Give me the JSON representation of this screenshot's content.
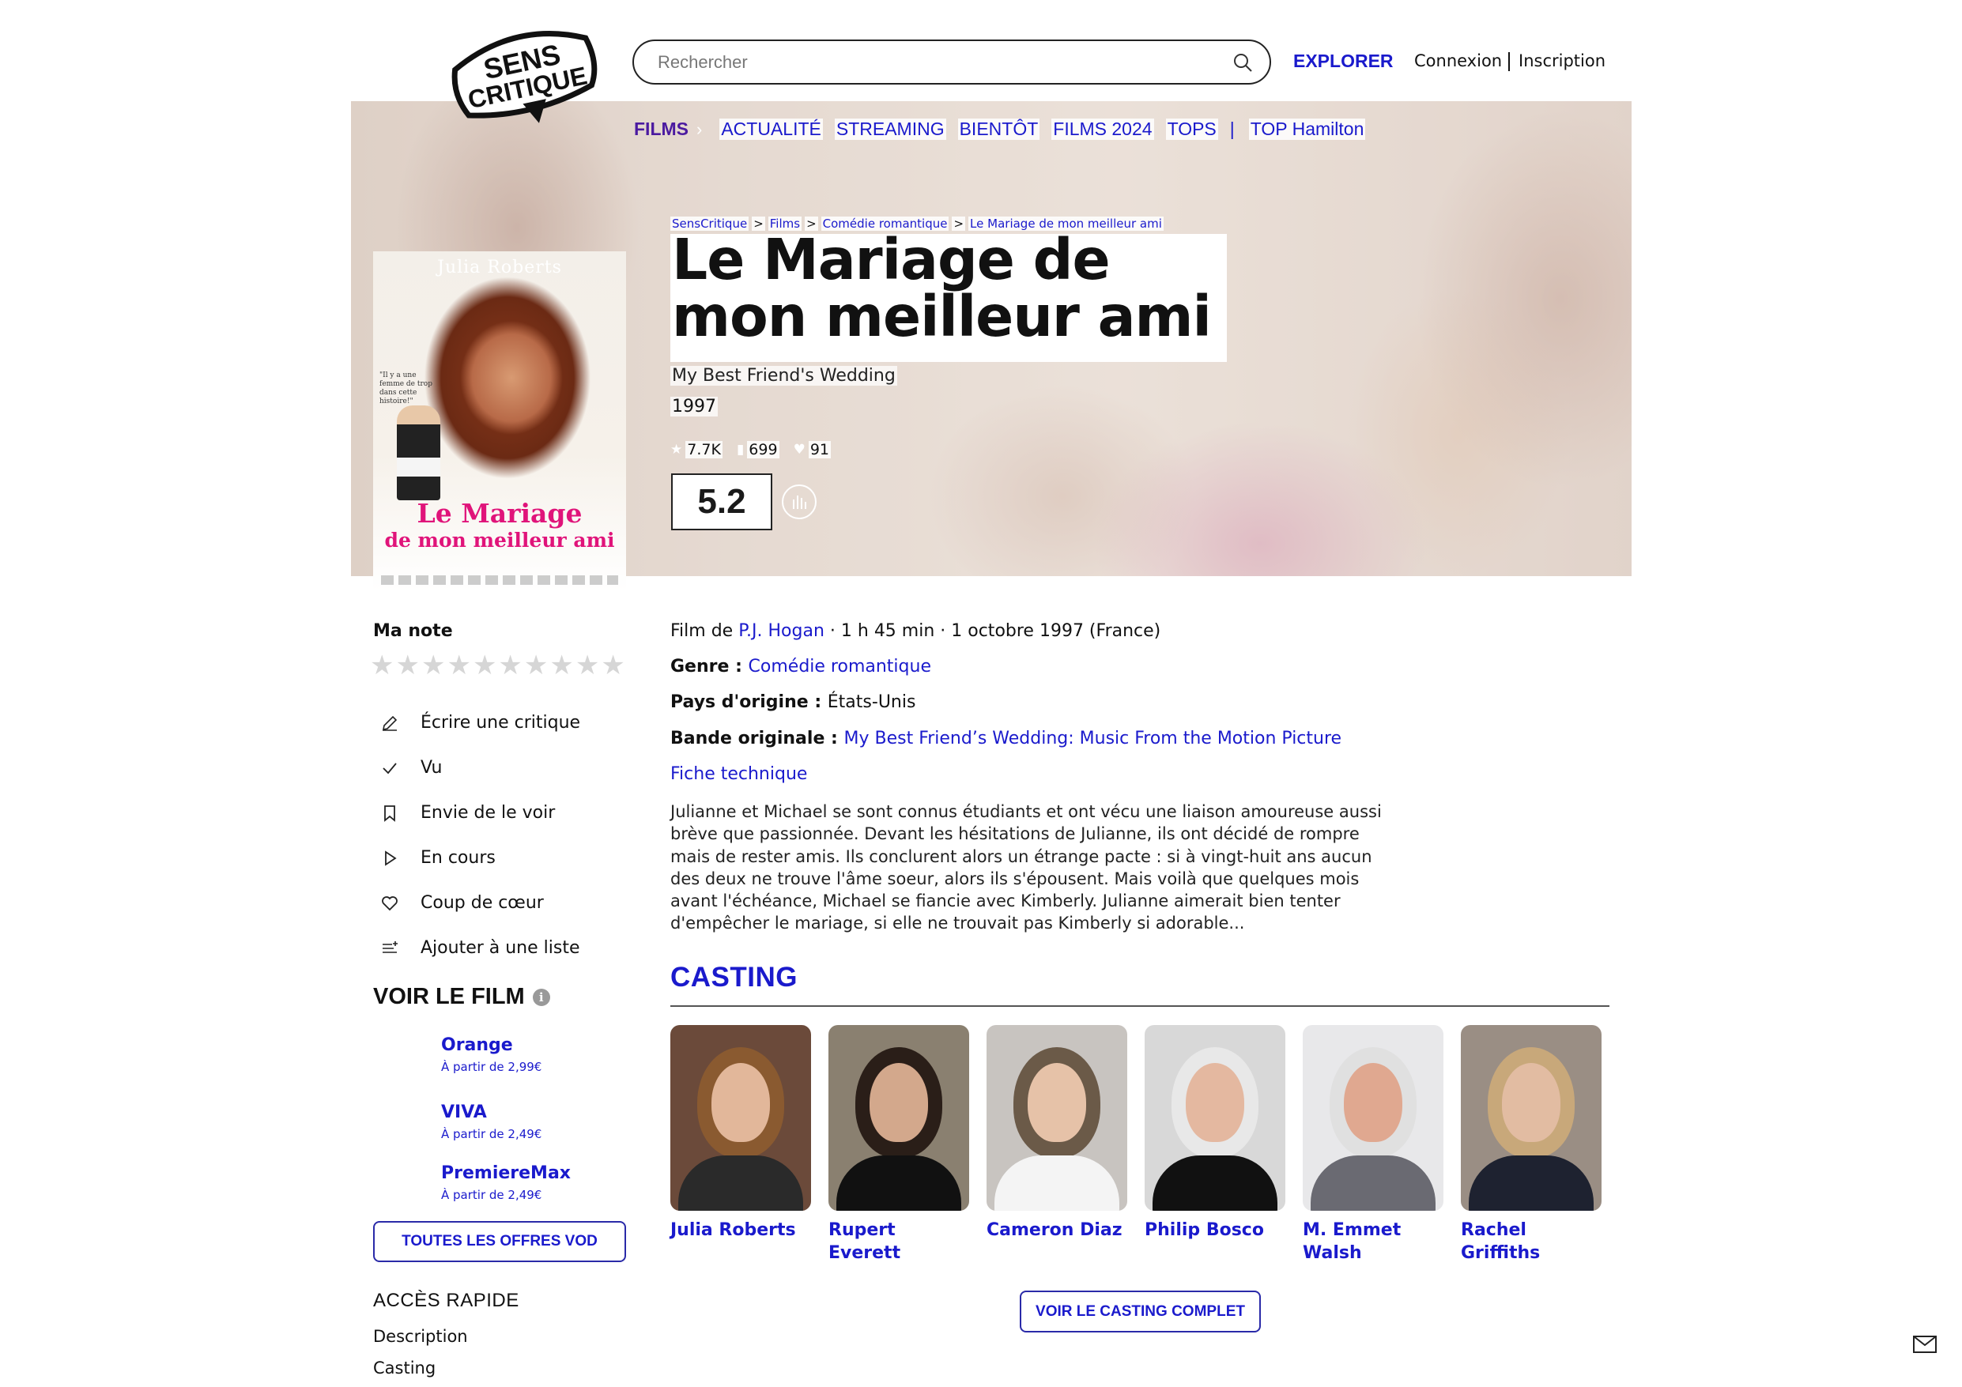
{
  "header": {
    "search_placeholder": "Rechercher",
    "explorer": "EXPLORER",
    "connexion": "Connexion",
    "inscription": "Inscription",
    "logo_text_1": "SENS",
    "logo_text_2": "CRITIQUE"
  },
  "catnav": {
    "films": "FILMS",
    "chevron": "›",
    "items": [
      "ACTUALITÉ",
      "STREAMING",
      "BIENTÔT",
      "FILMS 2024",
      "TOPS"
    ],
    "separator": "|",
    "top_extra": "TOP Hamilton"
  },
  "breadcrumb": {
    "items": [
      "SensCritique",
      "Films",
      "Comédie romantique",
      "Le Mariage de mon meilleur ami"
    ],
    "gt": ">"
  },
  "movie": {
    "title": "Le Mariage de mon meilleur ami",
    "original_title": "My Best Friend's Wedding",
    "year": "1997",
    "stats": {
      "ratings": "7.7K",
      "wishlist": "699",
      "favorites": "91"
    },
    "score": "5.2",
    "poster": {
      "author": "Julia Roberts",
      "quote": "\"Il y a une femme de trop dans cette histoire!\"",
      "title_line1": "Le Mariage",
      "title_line2": "de mon meilleur ami"
    }
  },
  "sidebar": {
    "ma_note": "Ma note",
    "star_glyph": "★",
    "star_count": 10,
    "actions": [
      {
        "label": "Écrire une critique",
        "icon": "pencil-icon"
      },
      {
        "label": "Vu",
        "icon": "check-icon"
      },
      {
        "label": "Envie de le voir",
        "icon": "bookmark-icon"
      },
      {
        "label": "En cours",
        "icon": "play-icon"
      },
      {
        "label": "Coup de cœur",
        "icon": "heart-icon"
      },
      {
        "label": "Ajouter à une liste",
        "icon": "list-add-icon"
      }
    ],
    "voir_le_film": "VOIR LE FILM",
    "info_glyph": "i",
    "offers": [
      {
        "name": "Orange",
        "price": "À partir de 2,99€"
      },
      {
        "name": "VIVA",
        "price": "À partir de 2,49€"
      },
      {
        "name": "PremiereMax",
        "price": "À partir de 2,49€"
      }
    ],
    "vod_button": "TOUTES LES OFFRES VOD",
    "acces_rapide": "ACCÈS RAPIDE",
    "quick_links": [
      "Description",
      "Casting"
    ]
  },
  "details": {
    "film_de_prefix": "Film de ",
    "director": "P.J. Hogan",
    "film_meta": " · 1 h 45 min · 1 octobre 1997 (France)",
    "genre_label": "Genre : ",
    "genre": "Comédie romantique",
    "pays_label": "Pays d'origine : ",
    "pays": "États-Unis",
    "bo_label": "Bande originale : ",
    "bo": "My Best Friend’s Wedding: Music From the Motion Picture",
    "fiche": "Fiche technique",
    "synopsis": "Julianne et Michael se sont connus étudiants et ont vécu une liaison amoureuse aussi brève que passionnée. Devant les hésitations de Julianne, ils ont décidé de rompre mais de rester amis. Ils conclurent alors un étrange pacte : si à vingt-huit ans aucun des deux ne trouve l'âme soeur, alors ils s'épousent. Mais voilà que quelques mois avant l'échéance, Michael se fiancie avec Kimberly. Julianne aimerait bien tenter d'empêcher le mariage, si elle ne trouvait pas Kimberly si adorable..."
  },
  "casting": {
    "title": "CASTING",
    "actors": [
      {
        "name": "Julia Roberts",
        "bg": "#6b4a3a",
        "hair": "#8a5a30",
        "skin": "#e2b79a",
        "cloth": "#2a2a2a"
      },
      {
        "name": "Rupert Everett",
        "bg": "#8a8070",
        "hair": "#2a1e18",
        "skin": "#d3a88c",
        "cloth": "#111111"
      },
      {
        "name": "Cameron Diaz",
        "bg": "#c8c4c0",
        "hair": "#6b5a48",
        "skin": "#e6c2a8",
        "cloth": "#f4f4f4"
      },
      {
        "name": "Philip Bosco",
        "bg": "#d8d8d8",
        "hair": "#e8e8e8",
        "skin": "#e4b8a0",
        "cloth": "#111111"
      },
      {
        "name": "M. Emmet Walsh",
        "bg": "#e8e8ea",
        "hair": "#e0e0e0",
        "skin": "#e0a890",
        "cloth": "#6a6a72"
      },
      {
        "name": "Rachel Griffiths",
        "bg": "#9a8e84",
        "hair": "#c8a87a",
        "skin": "#e2bca2",
        "cloth": "#1e2230"
      }
    ],
    "button": "VOIR LE CASTING COMPLET"
  }
}
